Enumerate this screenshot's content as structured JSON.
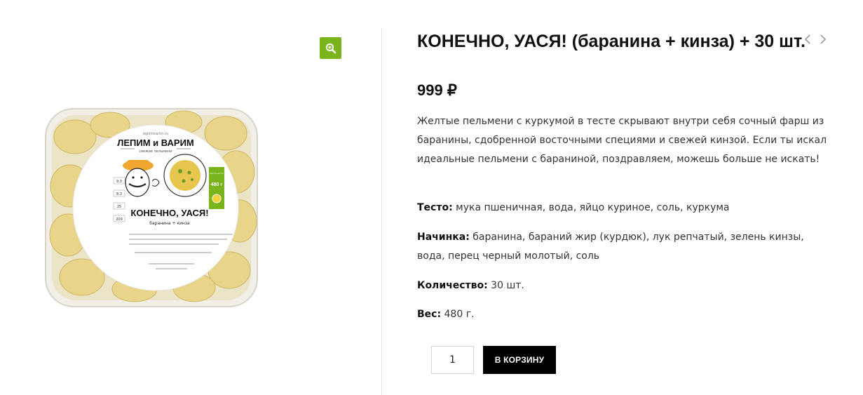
{
  "product": {
    "title": "КОНЕЧНО, УАСЯ! (баранина + кинза) + 30 шт.",
    "price": "999 ₽",
    "description": "Желтые пельмени с куркумой в тесте скрывают внутри себя сочный фарш из баранины, сдобренной восточными специями и свежей кинзой. Если ты искал идеальные пельмени с бараниной, поздравляем, можешь больше не искать!",
    "attributes": {
      "dough_label": "Тесто:",
      "dough_value": " мука пшеничная, вода, яйцо куриное, соль, куркума",
      "filling_label": "Начинка:",
      "filling_value": " баранина, бараний жир (курдюк), лук репчатый, зелень кинзы, вода, перец черный молотый, соль",
      "quantity_label": "Количество:",
      "quantity_value": " 30 шт.",
      "weight_label": "Вес:",
      "weight_value": " 480 г."
    }
  },
  "image": {
    "brand_line1": "ЛЕПИМ и ВАРИМ",
    "brand_line2": "свежие пельмени",
    "site": "lepimivarim.ru",
    "label_title": "КОНЕЧНО, УАСЯ!",
    "label_subtitle": "баранина + кинза",
    "weight_badge": "480 г",
    "weight_badge_top": "масса нетто",
    "nutrition": [
      "9,3",
      "8,3",
      "25",
      "209"
    ]
  },
  "cart": {
    "quantity": "1",
    "add_label": "В КОРЗИНУ"
  },
  "colors": {
    "accent": "#7ab41d",
    "button_bg": "#000000",
    "text": "#222222"
  },
  "icons": {
    "zoom": "zoom-in-icon",
    "prev": "chevron-left-icon",
    "next": "chevron-right-icon"
  }
}
